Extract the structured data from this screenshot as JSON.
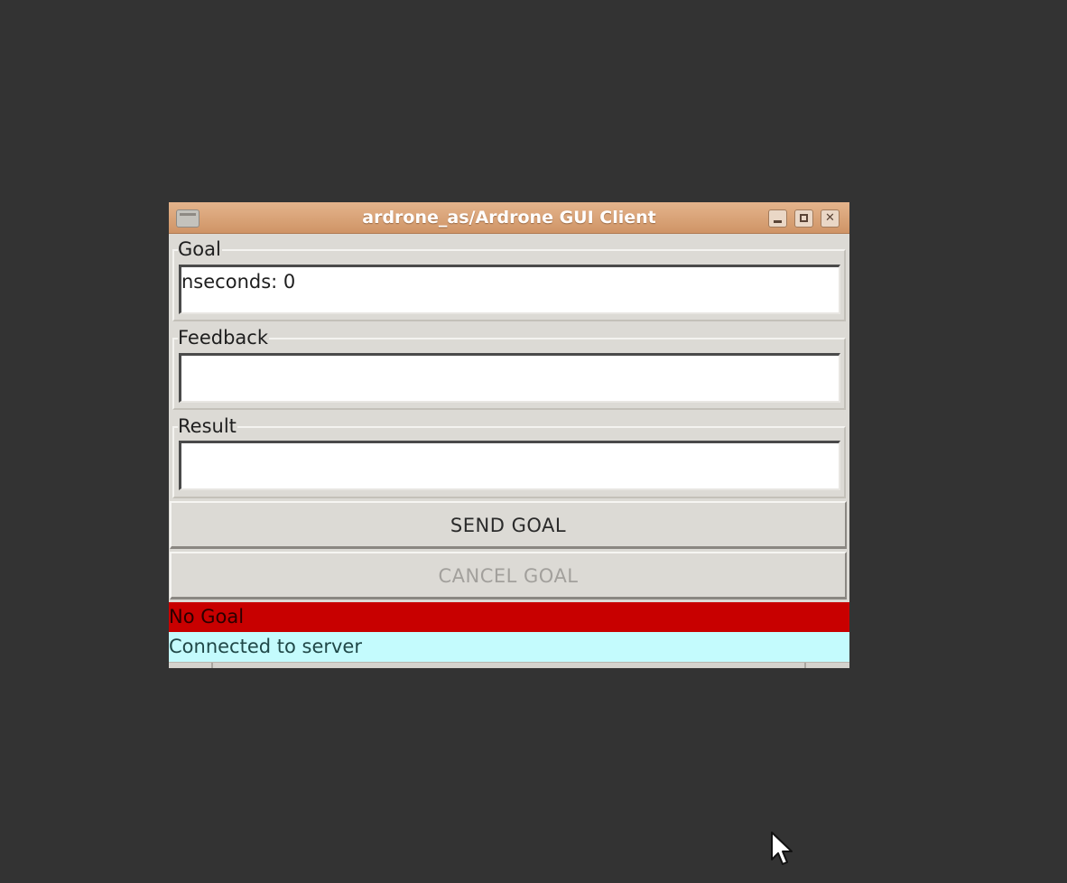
{
  "window": {
    "title": "ardrone_as/Ardrone GUI Client",
    "title_bar_color": "#d9a67a"
  },
  "goal": {
    "label": "Goal",
    "value": "nseconds: 0"
  },
  "feedback": {
    "label": "Feedback",
    "value": ""
  },
  "result": {
    "label": "Result",
    "value": ""
  },
  "buttons": {
    "send_label": "SEND GOAL",
    "cancel_label": "CANCEL GOAL",
    "cancel_enabled": false
  },
  "status": {
    "goal_text": "No Goal",
    "goal_color": "#c80000",
    "connection_text": "Connected to server",
    "connection_color": "#c4fbfd"
  },
  "icons": [
    "window-menu-icon",
    "minimize-icon",
    "maximize-icon",
    "close-icon",
    "mouse-cursor-icon"
  ]
}
